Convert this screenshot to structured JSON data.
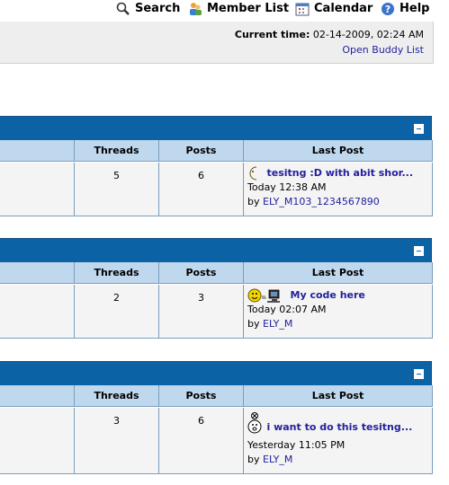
{
  "nav": {
    "search": "Search",
    "members": "Member List",
    "calendar": "Calendar",
    "help": "Help"
  },
  "info": {
    "time_label": "Current time:",
    "time_value": "02-14-2009, 02:24 AM",
    "buddy": "Open Buddy List"
  },
  "forums": [
    {
      "headers": {
        "threads": "Threads",
        "posts": "Posts",
        "lastpost": "Last Post"
      },
      "threads": "5",
      "posts": "6",
      "title": "tesitng :D with abit shor...",
      "time": "Today 12:38 AM",
      "by": "by",
      "user": "ELY_M103_1234567890",
      "icon": "moon-smiley-icon"
    },
    {
      "headers": {
        "threads": "Threads",
        "posts": "Posts",
        "lastpost": "Last Post"
      },
      "threads": "2",
      "posts": "3",
      "title": "My code here",
      "time": "Today 02:07 AM",
      "by": "by",
      "user": "ELY_M",
      "icon": "computer-smiley-icon"
    },
    {
      "headers": {
        "threads": "Threads",
        "posts": "Posts",
        "lastpost": "Last Post"
      },
      "threads": "3",
      "posts": "6",
      "title": "i want to do this tesitng...",
      "time": "Yesterday 11:05 PM",
      "by": "by",
      "user": "ELY_M",
      "icon": "bug-smiley-icon"
    }
  ],
  "colors": {
    "header_blue": "#0b63a5",
    "column_header": "#c0d8ee",
    "link": "#22229c"
  }
}
